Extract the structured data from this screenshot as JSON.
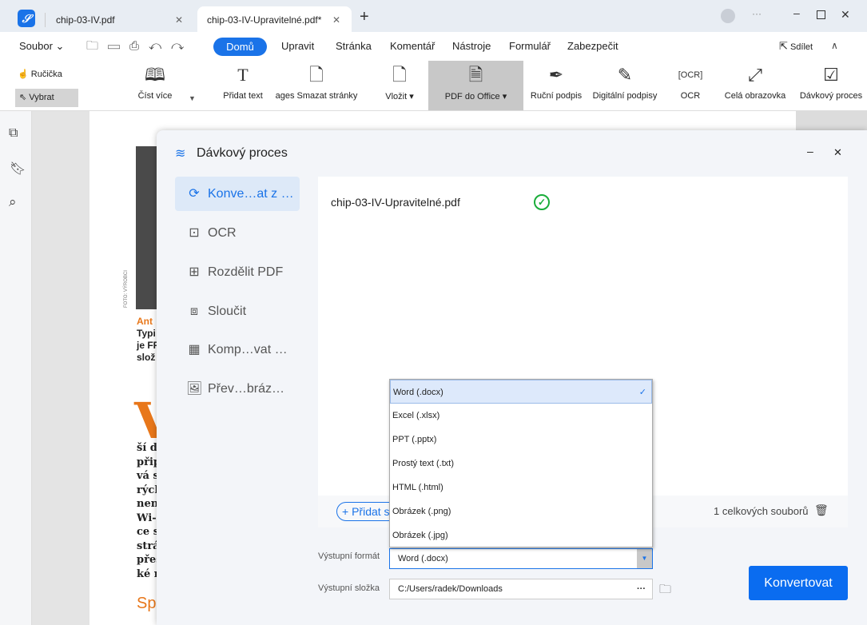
{
  "tabs": [
    {
      "label": "chip-03-IV.pdf",
      "active": false
    },
    {
      "label": "chip-03-IV-Upravitelné.pdf*",
      "active": true
    }
  ],
  "menu": {
    "file": "Soubor",
    "items": [
      "Domů",
      "Upravit",
      "Stránka",
      "Komentář",
      "Nástroje",
      "Formulář",
      "Zabezpečit"
    ],
    "active": "Domů",
    "share": "Sdílet"
  },
  "ribbon": {
    "hand": "Ručička",
    "select": "Vybrat",
    "tools": [
      {
        "label": "Číst více",
        "icon": "book-icon"
      },
      {
        "label": "Přidat text",
        "icon": "text-icon"
      },
      {
        "label": "ages Smazat stránky",
        "icon": "delete-page-icon"
      },
      {
        "label": "Vložit",
        "icon": "insert-page-icon"
      },
      {
        "label": "PDF do Office",
        "icon": "pdf-to-word-icon"
      },
      {
        "label": "Ruční podpis",
        "icon": "pen-icon"
      },
      {
        "label": "Digitální podpisy",
        "icon": "pencil-icon"
      },
      {
        "label": "OCR",
        "icon": "ocr-icon"
      },
      {
        "label": "Celá obrazovka",
        "icon": "fullscreen-icon"
      },
      {
        "label": "Dávkový proces",
        "icon": "batch-icon"
      }
    ]
  },
  "document": {
    "photo_credit": "FOTO: VÝROBCI",
    "caption_lines": [
      "Ant",
      "Typi",
      "je FF",
      "slož"
    ],
    "drop_cap": "V",
    "body_lines": [
      "ší d",
      "přip",
      "vá s",
      "rých",
      "nen",
      "Wi-I",
      "ce s",
      "strá",
      "přes",
      "ké r"
    ],
    "subhead": "Sp"
  },
  "dialog": {
    "title": "Dávkový proces",
    "nav": [
      {
        "label": "Konve…at z …",
        "icon": "convert-icon",
        "active": true
      },
      {
        "label": "OCR",
        "icon": "ocr-icon"
      },
      {
        "label": "Rozdělit PDF",
        "icon": "split-icon"
      },
      {
        "label": "Sloučit",
        "icon": "merge-icon"
      },
      {
        "label": "Komp…vat …",
        "icon": "compress-icon"
      },
      {
        "label": "Přev…bráz…",
        "icon": "image-icon"
      }
    ],
    "file": {
      "name": "chip-03-IV-Upravitelné.pdf",
      "status": "done"
    },
    "add_label": "Přidat s",
    "total": "1 celkových souborů",
    "format_label": "Výstupní formát",
    "format_value": "Word (.docx)",
    "format_options": [
      "Word (.docx)",
      "Excel (.xlsx)",
      "PPT (.pptx)",
      "Prostý text (.txt)",
      "HTML (.html)",
      "Obrázek (.png)",
      "Obrázek (.jpg)"
    ],
    "folder_label": "Výstupní složka",
    "folder_value": "C:/Users/radek/Downloads",
    "convert": "Konvertovat"
  },
  "colors": {
    "accent": "#1a73e8",
    "success": "#1aad3a",
    "orange": "#e8771a"
  }
}
